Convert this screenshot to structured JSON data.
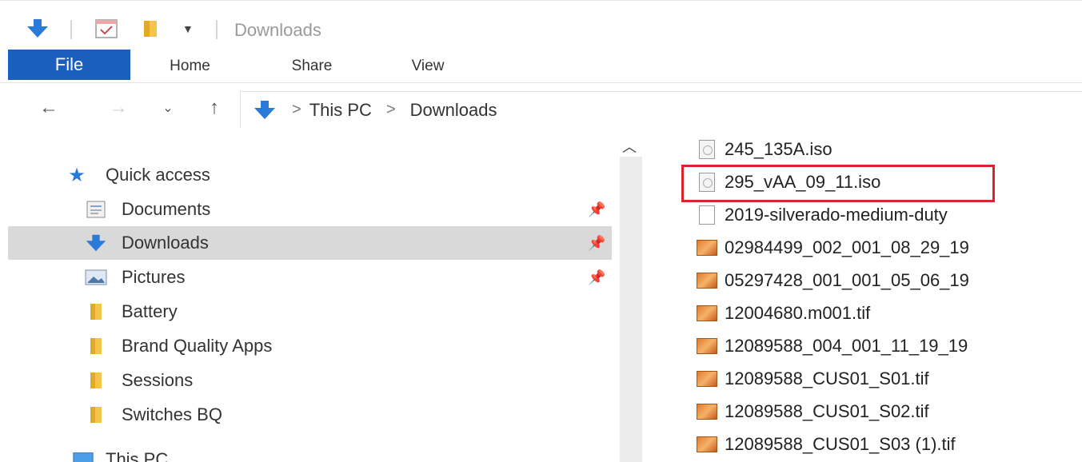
{
  "window": {
    "title": "Downloads"
  },
  "quick_toolbar": {
    "icons": [
      "downloads-arrow-icon",
      "properties-check-icon",
      "new-folder-icon",
      "dropdown-arrow-icon"
    ]
  },
  "ribbon": {
    "tabs": [
      {
        "label": "File",
        "active": true
      },
      {
        "label": "Home"
      },
      {
        "label": "Share"
      },
      {
        "label": "View"
      }
    ]
  },
  "address": {
    "breadcrumbs": [
      "This PC",
      "Downloads"
    ],
    "separator": ">"
  },
  "nav": {
    "quick_access_label": "Quick access",
    "items": [
      {
        "label": "Documents",
        "icon": "documents-icon",
        "pinned": true
      },
      {
        "label": "Downloads",
        "icon": "downloads-icon",
        "pinned": true,
        "selected": true
      },
      {
        "label": "Pictures",
        "icon": "pictures-icon",
        "pinned": true
      },
      {
        "label": "Battery",
        "icon": "folder-icon"
      },
      {
        "label": "Brand Quality Apps",
        "icon": "folder-icon"
      },
      {
        "label": "Sessions",
        "icon": "folder-icon"
      },
      {
        "label": "Switches BQ",
        "icon": "folder-icon"
      }
    ],
    "this_pc_label": "This PC"
  },
  "files": [
    {
      "name": "245_135A.iso",
      "type": "iso"
    },
    {
      "name": "295_vAA_09_11.iso",
      "type": "iso",
      "highlighted": true
    },
    {
      "name": "2019-silverado-medium-duty",
      "type": "blank"
    },
    {
      "name": "02984499_002_001_08_29_19",
      "type": "tif"
    },
    {
      "name": "05297428_001_001_05_06_19",
      "type": "tif"
    },
    {
      "name": "12004680.m001.tif",
      "type": "tif"
    },
    {
      "name": "12089588_004_001_11_19_19",
      "type": "tif"
    },
    {
      "name": "12089588_CUS01_S01.tif",
      "type": "tif"
    },
    {
      "name": "12089588_CUS01_S02.tif",
      "type": "tif"
    },
    {
      "name": "12089588_CUS01_S03 (1).tif",
      "type": "tif"
    }
  ],
  "colors": {
    "accent": "#1b5fbe",
    "highlight_border": "#d9242b",
    "selected_bg": "#d9d9d9"
  }
}
